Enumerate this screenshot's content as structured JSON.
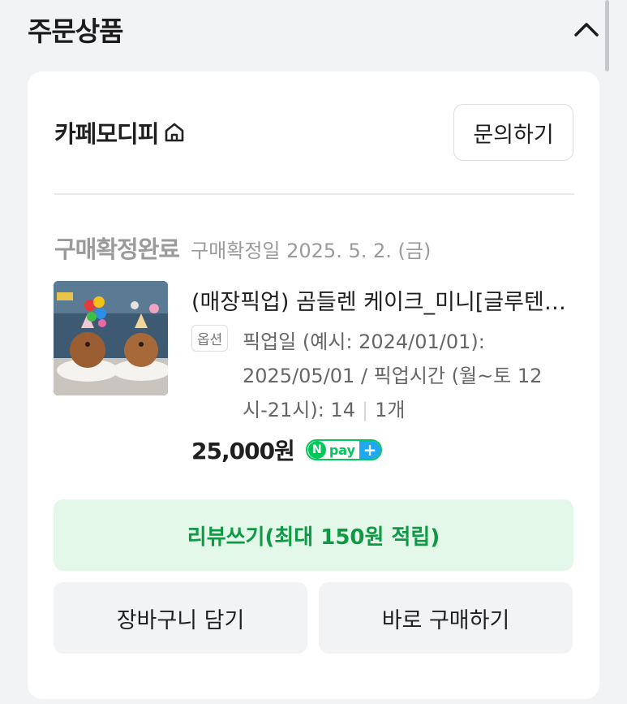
{
  "section": {
    "title": "주문상품",
    "collapse_icon": "chevron-up-icon"
  },
  "seller": {
    "name": "카페모디피",
    "home_icon": "home-icon",
    "inquiry_label": "문의하기"
  },
  "order": {
    "status": "구매확정완료",
    "confirmed_date": "구매확정일 2025. 5. 2. (금)"
  },
  "product": {
    "name": "(매장픽업) 곰들렌 케이크_미니[글루텐프리]",
    "option_badge": "옵션",
    "option_text": "픽업일 (예시: 2024/01/01): 2025/05/01 / 픽업시간 (월~토 12시-21시): 14",
    "quantity": "1개",
    "price": "25,000원",
    "pay_badge": {
      "n": "N",
      "text": "pay",
      "plus": "+"
    }
  },
  "actions": {
    "review_label": "리뷰쓰기(최대 150원 적립)",
    "cart_label": "장바구니 담기",
    "buy_label": "바로 구매하기"
  },
  "colors": {
    "accent_green": "#0e9a44",
    "review_bg": "#e4f8ea",
    "npay_green": "#03c75a",
    "npay_blue": "#1ea8f0"
  }
}
